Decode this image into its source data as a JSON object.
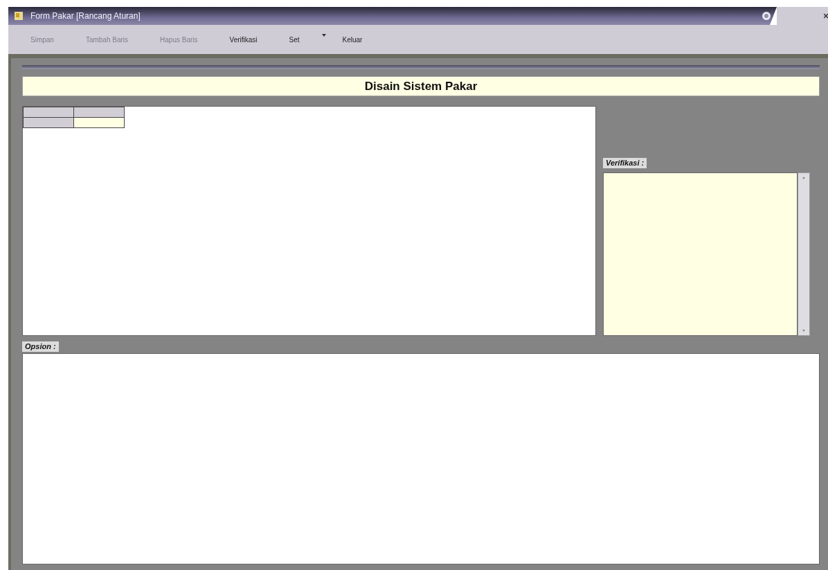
{
  "window": {
    "title": "Form Pakar [Rancang Aturan]"
  },
  "toolbar": [
    {
      "label": "Simpan",
      "disabled": true,
      "has_menu": false
    },
    {
      "label": "Tambah Baris",
      "disabled": true,
      "has_menu": false
    },
    {
      "label": "Hapus Baris",
      "disabled": true,
      "has_menu": false
    },
    {
      "label": "Verifikasi",
      "disabled": false,
      "has_menu": false
    },
    {
      "label": "Set",
      "disabled": false,
      "has_menu": true
    },
    {
      "label": "Keluar",
      "disabled": false,
      "has_menu": false
    }
  ],
  "header": {
    "title": "Disain Sistem Pakar"
  },
  "rule_grid": {
    "rows": [
      {
        "cells": [
          {
            "kind": "header"
          },
          {
            "kind": "header"
          }
        ]
      },
      {
        "cells": [
          {
            "kind": "header"
          },
          {
            "kind": "input"
          }
        ]
      }
    ]
  },
  "verification": {
    "label": "Verifikasi :"
  },
  "options": {
    "label": "Opsion :"
  }
}
